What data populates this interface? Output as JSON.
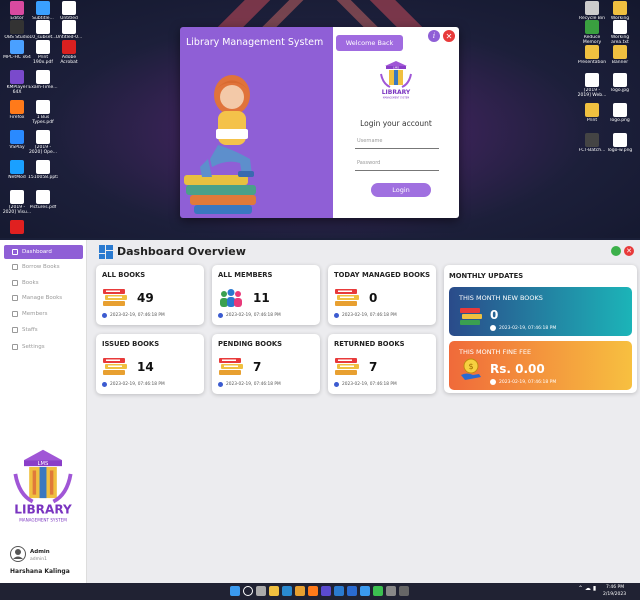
{
  "desktop": {
    "left_icons": [
      {
        "label": "Editor",
        "color": "#d94aa0"
      },
      {
        "label": "Subtitle...",
        "color": "#3aa0ff"
      },
      {
        "label": "Untitled",
        "color": "#ffffff"
      },
      {
        "label": "OBS Studio",
        "color": "#333333"
      },
      {
        "label": "10_subset...",
        "color": "#ffffff"
      },
      {
        "label": "Untitled-0...",
        "color": "#ffffff"
      },
      {
        "label": "MPC-HC x64",
        "color": "#4aa0ff"
      },
      {
        "label": "Print 190x.pdf",
        "color": "#ffffff"
      },
      {
        "label": "Adobe Acrobat",
        "color": "#d92020"
      },
      {
        "label": "KMPlayer 64X",
        "color": "#7a4acc"
      },
      {
        "label": "Exam-Time...",
        "color": "#ffffff"
      },
      {
        "label": "Firefox",
        "color": "#ff7a1a"
      },
      {
        "label": "1 Bus Types.pdf",
        "color": "#ffffff"
      },
      {
        "label": "VSPlay",
        "color": "#2a8aff"
      },
      {
        "label": "[2019 - 2020] Ope...",
        "color": "#ffffff"
      },
      {
        "label": "NetMod",
        "color": "#1aa0ff"
      },
      {
        "label": "1510058.pptx",
        "color": "#ffffff"
      },
      {
        "label": "[2019 - 2020] Visu...",
        "color": "#ffffff"
      },
      {
        "label": "Pictures.pdf",
        "color": "#ffffff"
      },
      {
        "label": "",
        "color": "#e02020"
      }
    ],
    "right_icons": [
      {
        "label": "Recycle Bin",
        "color": "#cccccc"
      },
      {
        "label": "Working Area",
        "color": "#f0c040"
      },
      {
        "label": "Reduce Memory",
        "color": "#3aa040"
      },
      {
        "label": "Working area.txt",
        "color": "#ffffff"
      },
      {
        "label": "Presentation",
        "color": "#f0c040"
      },
      {
        "label": "Banner",
        "color": "#f0c040"
      },
      {
        "label": "[2019 - 2019] Web...",
        "color": "#ffffff"
      },
      {
        "label": "logo.jpg",
        "color": "#ffffff"
      },
      {
        "label": "Print",
        "color": "#f0c040"
      },
      {
        "label": "logo.png",
        "color": "#ffffff"
      },
      {
        "label": "FCT-Batch...",
        "color": "#444444"
      },
      {
        "label": "logo-w.png",
        "color": "#ffffff"
      }
    ]
  },
  "login": {
    "title": "Library Management System",
    "welcome_button": "Welcome Back",
    "info_icon": "info-icon",
    "close_icon": "close-icon",
    "logo_top": "LMS",
    "logo_text": "LIBRARY",
    "logo_sub": "MANAGEMENT SYSTEM",
    "heading": "Login your account",
    "username_placeholder": "Username",
    "password_placeholder": "Password",
    "login_button": "Login",
    "accent": "#8f5fd6"
  },
  "sidebar": {
    "items": [
      {
        "label": "Dashboard",
        "icon": "dashboard-icon"
      },
      {
        "label": "Borrow Books",
        "icon": "borrow-icon"
      },
      {
        "label": "Books",
        "icon": "books-icon"
      },
      {
        "label": "Manage Books",
        "icon": "manage-icon"
      },
      {
        "label": "Members",
        "icon": "members-icon"
      },
      {
        "label": "Staffs",
        "icon": "staffs-icon"
      },
      {
        "label": "Settings",
        "icon": "settings-icon"
      }
    ],
    "logo_top": "LMS",
    "logo_text": "LIBRARY",
    "logo_sub": "MANAGEMENT SYSTEM",
    "user_role": "Admin",
    "user_sub": "admin1",
    "user_name": "Harshana Kalinga"
  },
  "dashboard": {
    "title": "Dashboard Overview",
    "cards": [
      {
        "title": "ALL BOOKS",
        "value": "49",
        "date": "2023-02-19, 07:46:18 PM",
        "icon": "books-stack-icon"
      },
      {
        "title": "ALL MEMBERS",
        "value": "11",
        "date": "2023-02-19, 07:46:18 PM",
        "icon": "members-group-icon"
      },
      {
        "title": "TODAY MANAGED BOOKS",
        "value": "0",
        "date": "2023-02-19, 07:46:18 PM",
        "icon": "books-stack-icon"
      },
      {
        "title": "ISSUED BOOKS",
        "value": "14",
        "date": "2023-02-19, 07:46:18 PM",
        "icon": "books-stack-icon"
      },
      {
        "title": "PENDING BOOKS",
        "value": "7",
        "date": "2023-02-19, 07:46:18 PM",
        "icon": "books-stack-icon"
      },
      {
        "title": "RETURNED BOOKS",
        "value": "7",
        "date": "2023-02-19, 07:46:18 PM",
        "icon": "books-stack-icon"
      }
    ],
    "monthly": {
      "title": "MONTHLY UPDATES",
      "new_books_title": "THIS MONTH NEW BOOKS",
      "new_books_value": "0",
      "new_books_date": "2023-02-19, 07:46:18 PM",
      "fine_title": "THIS MONTH FINE FEE",
      "fine_value": "Rs. 0.00",
      "fine_date": "2023-02-19, 07:46:18 PM"
    }
  },
  "taskbar": {
    "time": "7:46 PM",
    "date": "2/19/2023",
    "apps": [
      "windows-icon",
      "search-icon",
      "taskview-icon",
      "explorer-icon",
      "edge-icon",
      "chrome-icon",
      "firefox-icon",
      "vscode-icon",
      "todo-icon",
      "mail-icon",
      "photos-icon",
      "whatsapp-icon",
      "settings-icon",
      "calculator-icon"
    ]
  }
}
